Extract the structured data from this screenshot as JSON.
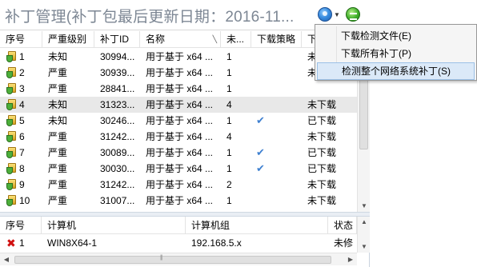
{
  "title": "补丁管理(补丁包最后更新日期：2016-11...",
  "toolbar": {
    "check_icon": "globe-search-icon",
    "update_icon": "green-update-icon"
  },
  "patch_grid": {
    "columns": [
      "序号",
      "严重级别",
      "补丁ID",
      "名称",
      "未...",
      "下载策略",
      "下"
    ],
    "rows": [
      {
        "num": "1",
        "severity": "未知",
        "id": "30994...",
        "name": "用于基于 x64 ...",
        "count": "1",
        "policy": "",
        "status": "未"
      },
      {
        "num": "2",
        "severity": "严重",
        "id": "30939...",
        "name": "用于基于 x64 ...",
        "count": "1",
        "policy": "",
        "status": "未"
      },
      {
        "num": "3",
        "severity": "严重",
        "id": "28841...",
        "name": "用于基于 x64 ...",
        "count": "1",
        "policy": "",
        "status": ""
      },
      {
        "num": "4",
        "severity": "未知",
        "id": "31323...",
        "name": "用于基于 x64 ...",
        "count": "4",
        "policy": "",
        "status": "未下载"
      },
      {
        "num": "5",
        "severity": "未知",
        "id": "30246...",
        "name": "用于基于 x64 ...",
        "count": "1",
        "policy": "✔",
        "status": "已下载"
      },
      {
        "num": "6",
        "severity": "严重",
        "id": "31242...",
        "name": "用于基于 x64 ...",
        "count": "4",
        "policy": "",
        "status": "未下载"
      },
      {
        "num": "7",
        "severity": "严重",
        "id": "30089...",
        "name": "用于基于 x64 ...",
        "count": "1",
        "policy": "✔",
        "status": "已下载"
      },
      {
        "num": "8",
        "severity": "严重",
        "id": "30030...",
        "name": "用于基于 x64 ...",
        "count": "1",
        "policy": "✔",
        "status": "已下载"
      },
      {
        "num": "9",
        "severity": "严重",
        "id": "31242...",
        "name": "用于基于 x64 ...",
        "count": "2",
        "policy": "",
        "status": "未下载"
      },
      {
        "num": "10",
        "severity": "严重",
        "id": "31007...",
        "name": "用于基于 x64 ...",
        "count": "1",
        "policy": "",
        "status": "未下载"
      }
    ]
  },
  "computer_grid": {
    "columns": [
      "序号",
      "计算机",
      "计算机组",
      "状态"
    ],
    "rows": [
      {
        "num": "1",
        "computer": "WIN8X64-1",
        "group": "192.168.5.x",
        "status": "未修"
      }
    ]
  },
  "context_menu": {
    "items": [
      {
        "label": "下载检测文件(E)"
      },
      {
        "label": "下载所有补丁(P)"
      },
      {
        "label": "检测整个网络系统补丁(S)"
      }
    ]
  }
}
